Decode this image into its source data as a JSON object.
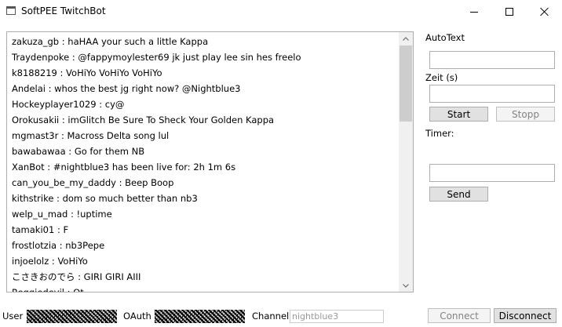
{
  "window": {
    "title": "SoftPEE TwitchBot"
  },
  "chat": {
    "lines": [
      "zakuza_gb : haHAA your such a little Kappa",
      "Traydenpoke : @fappymoylester69 jk just play lee sin hes freelo",
      "k8188219 : VoHiYo VoHiYo VoHiYo",
      "Andelai : whos the best jg right now? @Nightblue3",
      "Hockeyplayer1029 : cy@",
      "Orokusakii : imGlitch Be Sure To Sheck Your Golden Kappa",
      "mgmast3r : Macross Delta song lul",
      "bawabawaa : Go for them NB",
      "XanBot : #nightblue3 has been live for: 2h 1m 6s",
      "can_you_be_my_daddy : Beep Boop",
      "kithstrike : dom so much better than nb3",
      "welp_u_mad : !uptime",
      "tamaki01 : F",
      "frostlotzia : nb3Pepe",
      "injoelolz : VoHiYo",
      "こさきおのでら : GIRI GIRI AIII",
      "Reggiedevil : Ot"
    ]
  },
  "autotext": {
    "label": "AutoText",
    "value": "",
    "zeit_label": "Zeit (s)",
    "zeit_value": "",
    "start_label": "Start",
    "stop_label": "Stopp",
    "timer_label": "Timer:"
  },
  "send": {
    "value": "",
    "button_label": "Send"
  },
  "footer": {
    "user_label": "User",
    "oauth_label": "OAuth",
    "channel_label": "Channel",
    "channel_value": "nightblue3",
    "connect_label": "Connect",
    "disconnect_label": "Disconnect"
  }
}
